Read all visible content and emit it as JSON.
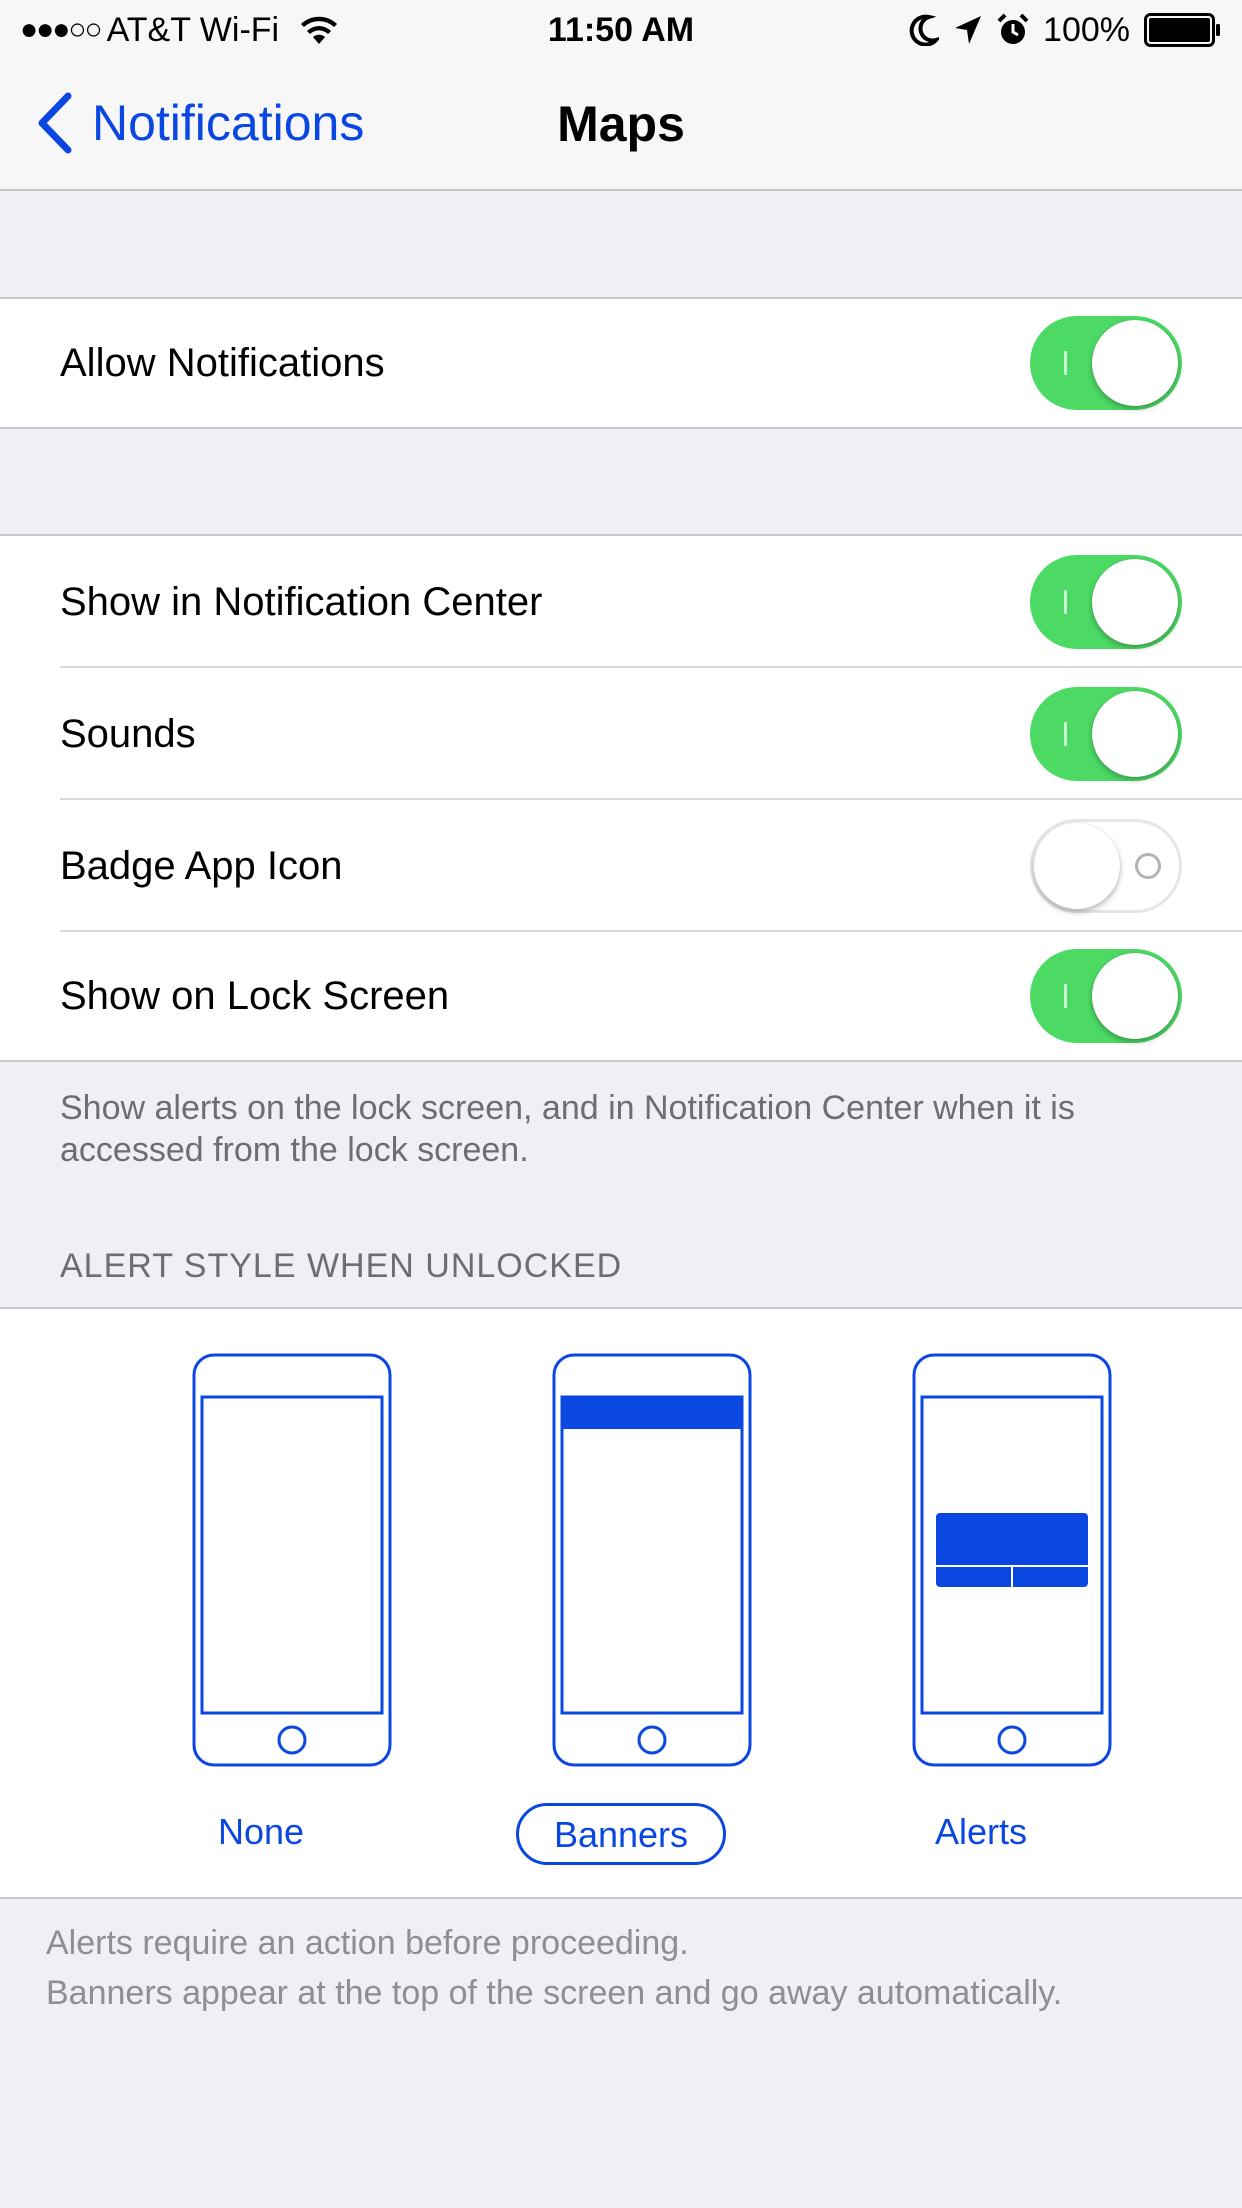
{
  "status_bar": {
    "signal": "●●●○○",
    "carrier": "AT&T Wi-Fi",
    "time": "11:50 AM",
    "battery_percent": "100%",
    "icons": [
      "wifi-icon",
      "moon-icon",
      "location-arrow-icon",
      "alarm-icon",
      "battery-icon"
    ]
  },
  "nav": {
    "back_label": "Notifications",
    "title": "Maps"
  },
  "colors": {
    "accent": "#0a47e0",
    "toggle_on": "#4cd964",
    "background": "#efeff4",
    "footer_text": "#6d6d72"
  },
  "settings": {
    "allow_notifications": {
      "label": "Allow Notifications",
      "on": true
    },
    "rows": [
      {
        "label": "Show in Notification Center",
        "on": true
      },
      {
        "label": "Sounds",
        "on": true
      },
      {
        "label": "Badge App Icon",
        "on": false
      },
      {
        "label": "Show on Lock Screen",
        "on": true
      }
    ],
    "lock_screen_footer": "Show alerts on the lock screen, and in Notification Center when it is accessed from the lock screen."
  },
  "alert_style": {
    "header": "ALERT STYLE WHEN UNLOCKED",
    "options": [
      {
        "label": "None",
        "selected": false
      },
      {
        "label": "Banners",
        "selected": true
      },
      {
        "label": "Alerts",
        "selected": false
      }
    ],
    "note_line1": "Alerts require an action before proceeding.",
    "note_line2": "Banners appear at the top of the screen and go away automatically."
  }
}
